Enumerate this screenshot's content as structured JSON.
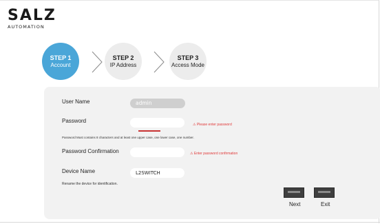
{
  "brand": {
    "name": "SALZ",
    "sub": "AUTOMATION"
  },
  "steps": [
    {
      "num": "STEP 1",
      "label": "Account"
    },
    {
      "num": "STEP 2",
      "label": "IP Address"
    },
    {
      "num": "STEP 3",
      "label": "Access Mode"
    }
  ],
  "form": {
    "username_label": "User Name",
    "username_value": "admin",
    "password_label": "Password",
    "password_value": "",
    "password_error": "⚠ Please enter password",
    "password_hint": "Password Must contains 8 characters and at least one upper case, one lower case, one number.",
    "confirm_label": "Password Confirmation",
    "confirm_value": "",
    "confirm_error": "⚠ Enter password confirmation",
    "device_label": "Device Name",
    "device_value": "L2SWITCH",
    "device_hint": "Rename the device for identification."
  },
  "buttons": {
    "next": "Next",
    "exit": "Exit"
  },
  "colors": {
    "active_step": "#4aa6d8",
    "error": "#e03a3a"
  }
}
